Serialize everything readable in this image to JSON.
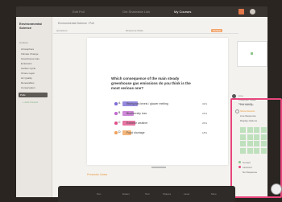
{
  "topbar": {
    "nav": [
      "Edit Poll",
      "Get Shareable Link",
      "My Courses"
    ],
    "active_index": 2
  },
  "sidebar": {
    "title": "Environmental Science",
    "section_label": "Content",
    "items": [
      "Atmosphere",
      "Climate Change",
      "Greenhouse Gas",
      "Emissions",
      "Carbon Cycle",
      "Ozone Layer",
      "Air Quality",
      "Renewables",
      "Conservation"
    ],
    "selected_item": "Polls",
    "add_link": "+ Add Content"
  },
  "breadcrumb": "Environmental Science › Poll",
  "subheader": {
    "left": "Questions",
    "middle": "Response Mode",
    "pill": "Multiple"
  },
  "question": {
    "text": "Which consequence of the main steady greenhouse gas emissions do you think is the most serious one?",
    "options": [
      {
        "letter": "A",
        "text": "Rising sea levels / glacier melting",
        "value": "32%",
        "color": "#7b6bd6",
        "fraction": 0.32
      },
      {
        "letter": "B",
        "text": "Biodiversity loss",
        "value": "24%",
        "color": "#c36ad0",
        "fraction": 0.24
      },
      {
        "letter": "C",
        "text": "Extreme weather",
        "value": "26%",
        "color": "#e0508a",
        "fraction": 0.26
      },
      {
        "letter": "D",
        "text": "Food shortage",
        "value": "18%",
        "color": "#f0a25a",
        "fraction": 0.18
      }
    ]
  },
  "prompt_link": "Presenter Notes",
  "right_panel": {
    "presenter_lines": [
      "Live",
      "Presenter Notes",
      "Show results"
    ],
    "highlight_lines": [
      "Poll Settings",
      "Show Results",
      "Live Response",
      "Display Options"
    ],
    "grid_count": 16,
    "legend": [
      "Correct",
      "Incorrect",
      "No Response"
    ]
  },
  "toolbar": {
    "tools": [
      "Pen",
      "Eraser",
      "Text",
      "Shapes",
      "Laser",
      "More"
    ]
  },
  "colors": {
    "accent": "#e8467c",
    "highlight_border": "#e8467c",
    "orange": "#e89a3a",
    "green": "#8bc48a"
  },
  "icons": {
    "bell": "notification-icon",
    "avatar": "user-avatar-icon",
    "corner": "help-icon"
  }
}
